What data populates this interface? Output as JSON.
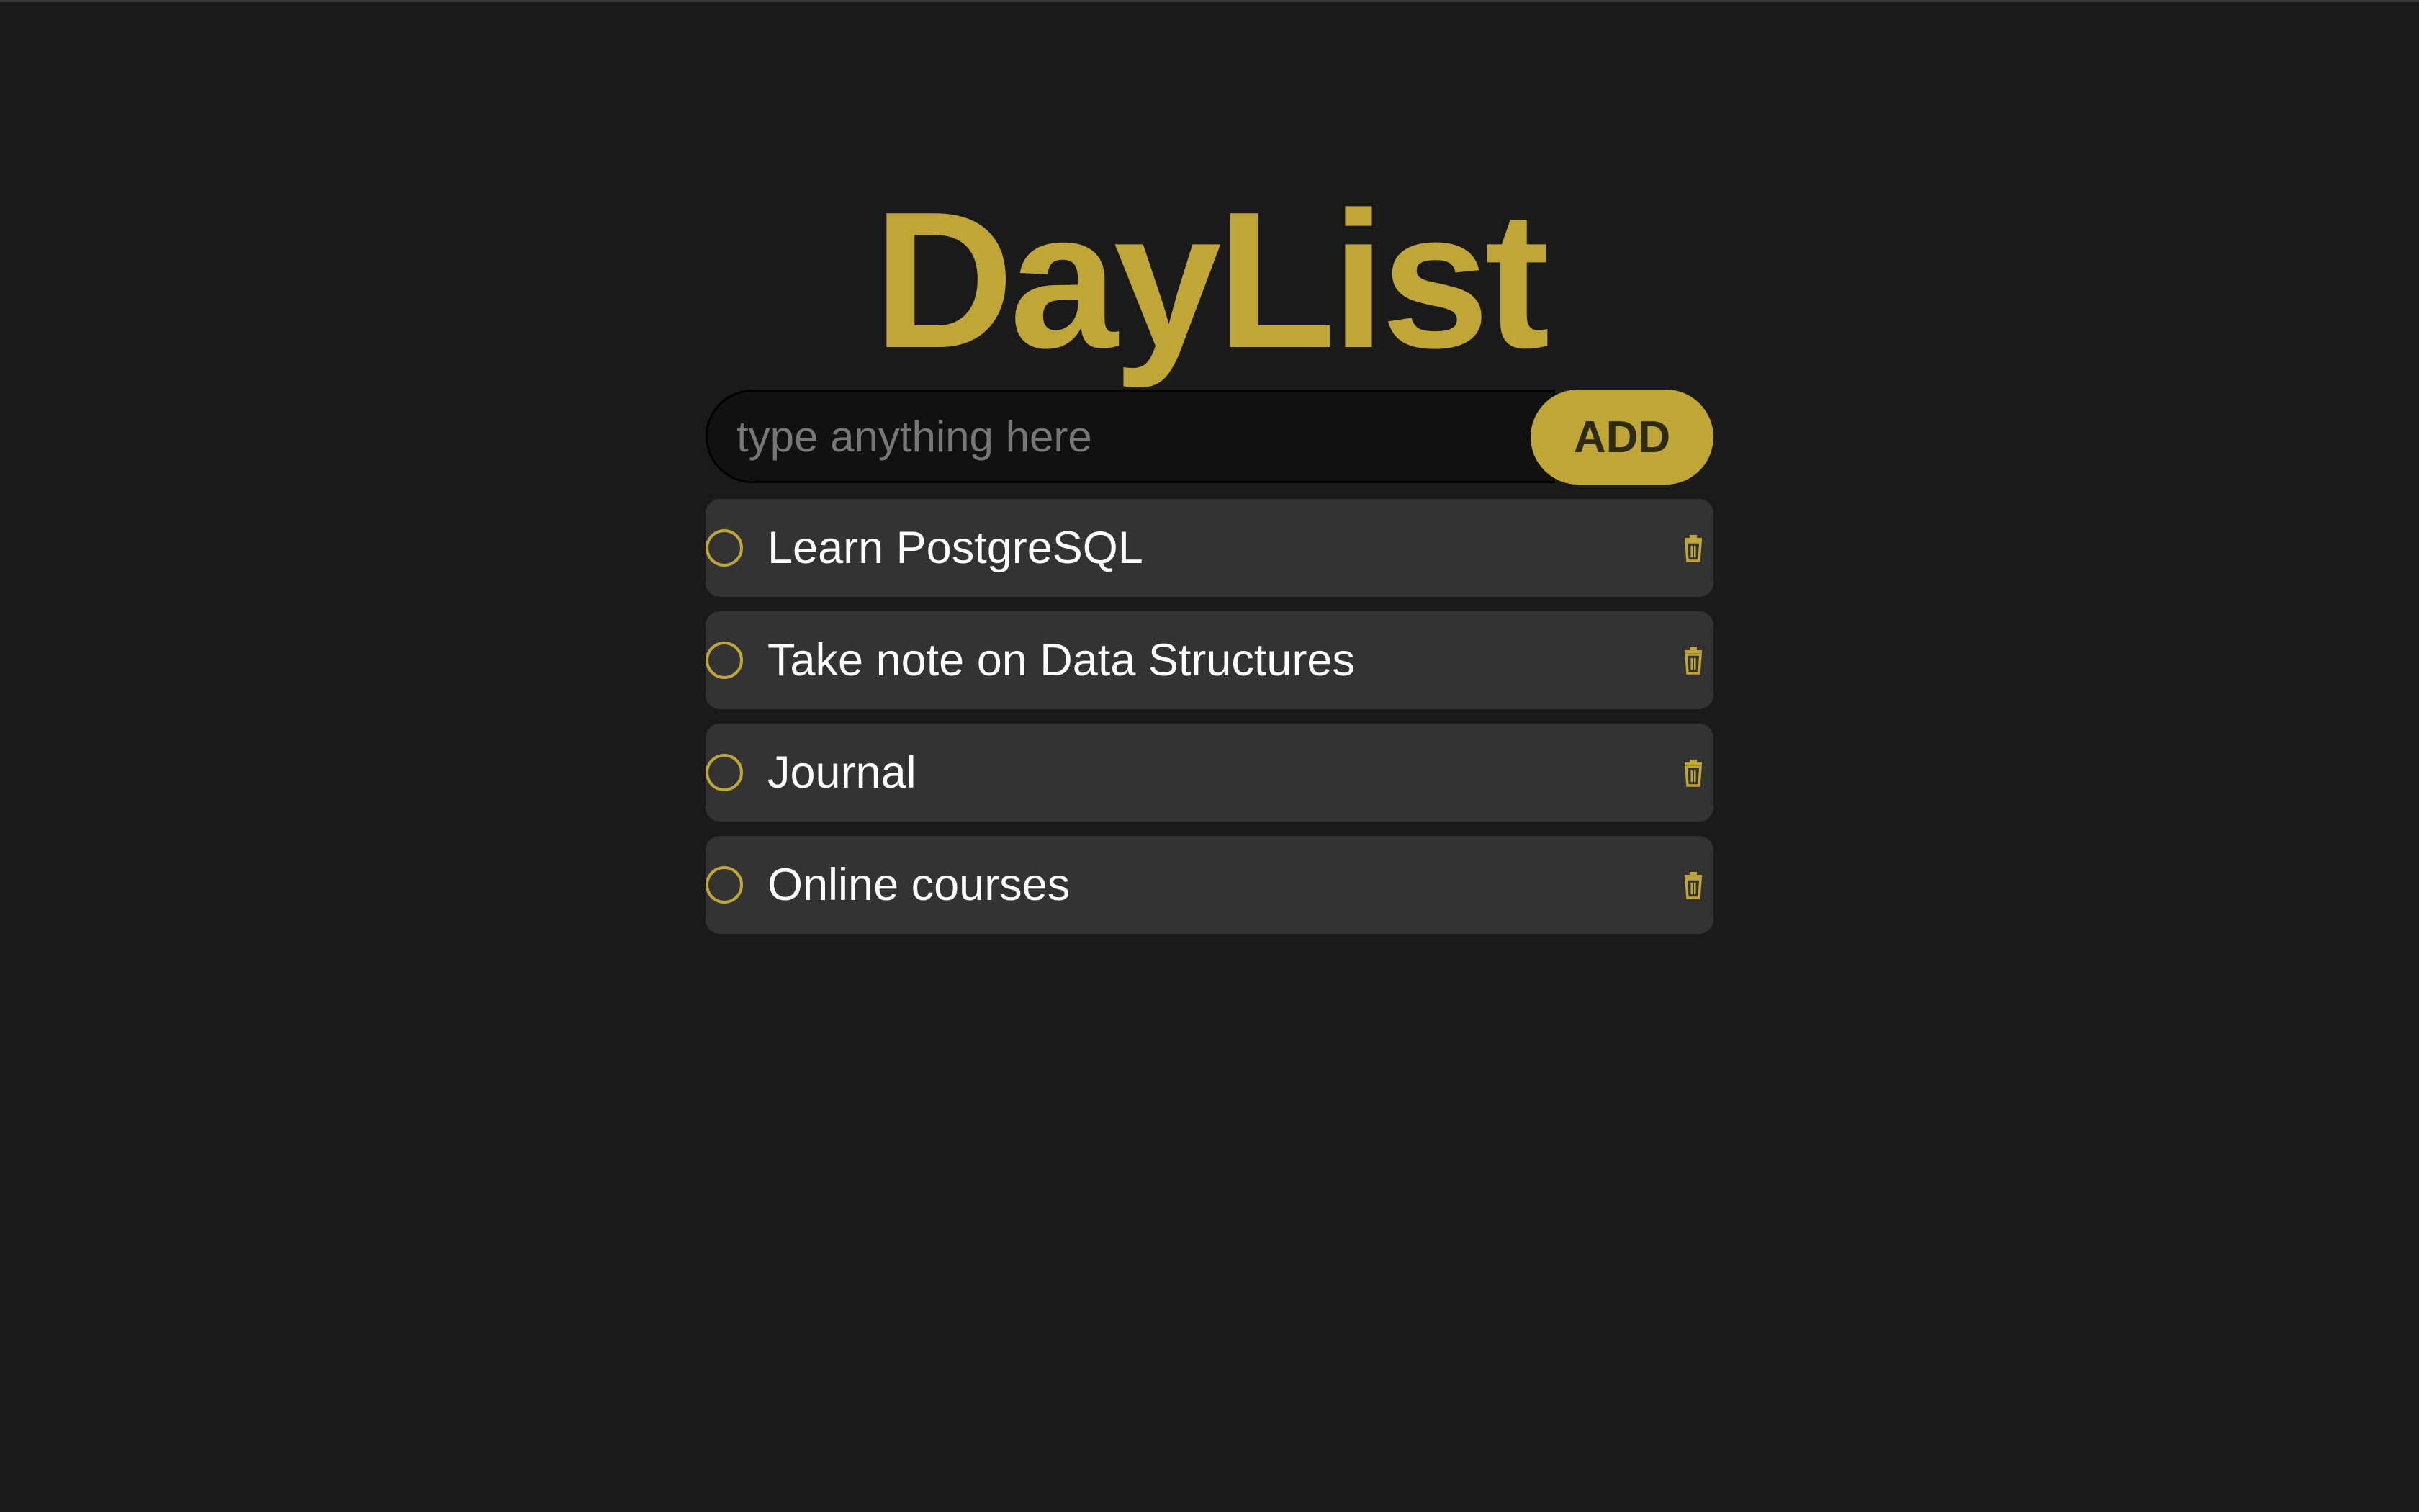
{
  "app": {
    "title": "DayList",
    "accent_color": "#c0a636",
    "background_color": "#1a1a1a"
  },
  "form": {
    "placeholder": "type anything here",
    "value": "",
    "add_label": "ADD"
  },
  "todos": [
    {
      "text": "Learn PostgreSQL",
      "done": false,
      "check_icon": "circle-outline-icon",
      "delete_icon": "trash-icon"
    },
    {
      "text": "Take note on Data Structures",
      "done": false,
      "check_icon": "circle-outline-icon",
      "delete_icon": "trash-icon"
    },
    {
      "text": "Journal",
      "done": false,
      "check_icon": "circle-outline-icon",
      "delete_icon": "trash-icon"
    },
    {
      "text": "Online courses",
      "done": false,
      "check_icon": "circle-outline-icon",
      "delete_icon": "trash-icon"
    }
  ]
}
